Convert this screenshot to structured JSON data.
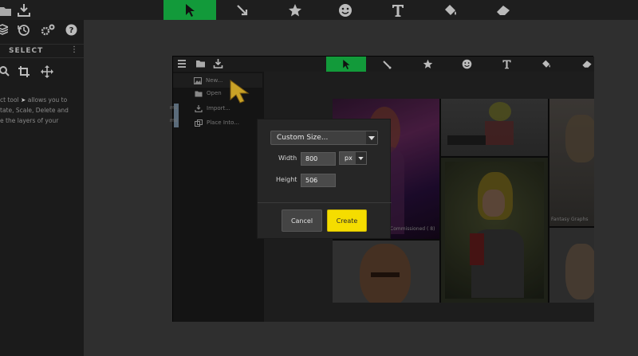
{
  "outer": {
    "sidebar": {
      "select_label": "SELECT",
      "help_lines": [
        "ct tool",
        "allows you to",
        "tate, Scale, Delete and",
        "e the layers of your"
      ]
    }
  },
  "inner": {
    "menu": {
      "new_label": "New...",
      "open_label": "Open",
      "import_label": "Import...",
      "place_label": "Place Into..."
    },
    "gallery_caption_1": "Commissioned ( 8)",
    "gallery_caption_2": "Fantasy Graphs"
  },
  "dialog": {
    "size_preset": "Custom Size...",
    "width_label": "Width",
    "width_value": "800",
    "unit": "px",
    "height_label": "Height",
    "height_value": "506",
    "cancel_label": "Cancel",
    "create_label": "Create"
  },
  "colors": {
    "active_tool": "#129a3a",
    "create_button": "#f5dd00",
    "cursor": "#c9a227"
  }
}
